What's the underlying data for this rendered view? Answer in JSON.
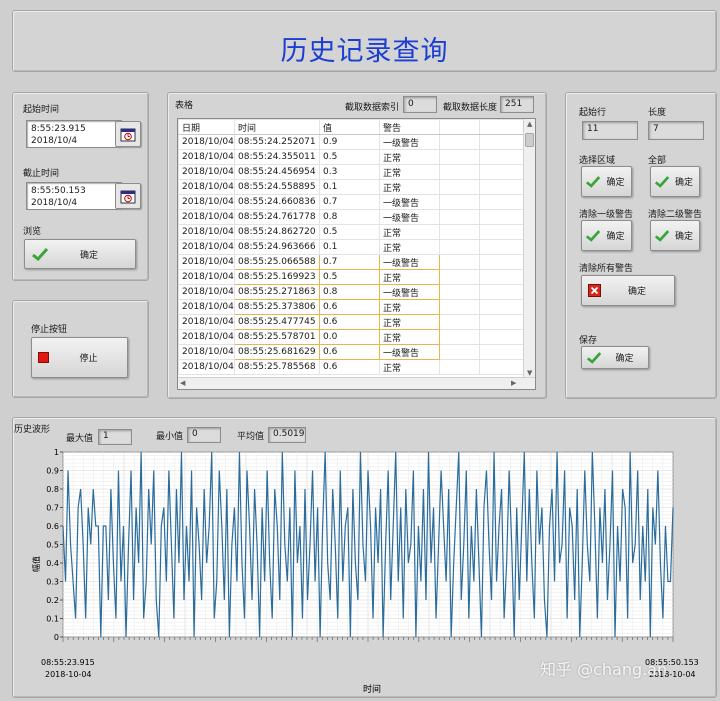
{
  "header": {
    "title": "历史记录查询"
  },
  "time_panel": {
    "start_label": "起始时间",
    "start_time": "8:55:23.915",
    "start_date": "2018/10/4",
    "end_label": "截止时间",
    "end_time": "8:55:50.153",
    "end_date": "2018/10/4",
    "browse_label": "浏览",
    "browse_button": "确定",
    "calendar_icon": "calendar-clock-icon"
  },
  "stop_panel": {
    "label": "停止按钮",
    "button": "停止",
    "indicator_color": "#e0190f"
  },
  "table_panel": {
    "label": "表格",
    "index_label": "截取数据索引",
    "index_value": "0",
    "length_label": "截取数据长度",
    "length_value": "251",
    "columns": [
      "日期",
      "时间",
      "值",
      "警告"
    ],
    "rows": [
      [
        "2018/10/04",
        "08:55:24.252071",
        "0.9",
        "一级警告"
      ],
      [
        "2018/10/04",
        "08:55:24.355011",
        "0.5",
        "正常"
      ],
      [
        "2018/10/04",
        "08:55:24.456954",
        "0.3",
        "正常"
      ],
      [
        "2018/10/04",
        "08:55:24.558895",
        "0.1",
        "正常"
      ],
      [
        "2018/10/04",
        "08:55:24.660836",
        "0.7",
        "一级警告"
      ],
      [
        "2018/10/04",
        "08:55:24.761778",
        "0.8",
        "一级警告"
      ],
      [
        "2018/10/04",
        "08:55:24.862720",
        "0.5",
        "正常"
      ],
      [
        "2018/10/04",
        "08:55:24.963666",
        "0.1",
        "正常"
      ],
      [
        "2018/10/04",
        "08:55:25.066588",
        "0.7",
        "一级警告"
      ],
      [
        "2018/10/04",
        "08:55:25.169923",
        "0.5",
        "正常"
      ],
      [
        "2018/10/04",
        "08:55:25.271863",
        "0.8",
        "一级警告"
      ],
      [
        "2018/10/04",
        "08:55:25.373806",
        "0.6",
        "正常"
      ],
      [
        "2018/10/04",
        "08:55:25.477745",
        "0.6",
        "正常"
      ],
      [
        "2018/10/04",
        "08:55:25.578701",
        "0.0",
        "正常"
      ],
      [
        "2018/10/04",
        "08:55:25.681629",
        "0.6",
        "一级警告"
      ],
      [
        "2018/10/04",
        "08:55:25.785568",
        "0.6",
        "正常"
      ]
    ],
    "highlighted_rows": [
      8,
      9,
      10,
      11,
      12,
      13,
      14
    ],
    "highlight_color": "#e1b84a"
  },
  "selection_panel": {
    "start_row_label": "起始行",
    "start_row_value": "11",
    "length_label": "长度",
    "length_value": "7",
    "select_region_label": "选择区域",
    "select_region_button": "确定",
    "all_label": "全部",
    "all_button": "确定",
    "clear_level1_label": "清除一级警告",
    "clear_level1_button": "确定",
    "clear_level2_label": "清除二级警告",
    "clear_level2_button": "确定",
    "clear_all_label": "清除所有警告",
    "clear_all_button": "确定",
    "save_label": "保存",
    "save_button": "确定"
  },
  "waveform_panel": {
    "label": "历史波形",
    "max_label": "最大值",
    "max_value": "1",
    "min_label": "最小值",
    "min_value": "0",
    "avg_label": "平均值",
    "avg_value": "0.5019"
  },
  "watermark": "知乎 @chang.an",
  "chart_data": {
    "type": "line",
    "title": "",
    "xlabel": "时间",
    "ylabel": "幅值",
    "x_start_label": [
      "08:55:23.915",
      "2018-10-04"
    ],
    "x_end_label": [
      "08:55:50.153",
      "2018-10-04"
    ],
    "ylim": [
      0,
      1
    ],
    "yticks": [
      "0",
      "0.1",
      "0.2",
      "0.3",
      "0.4",
      "0.5",
      "0.6",
      "0.7",
      "0.8",
      "0.9",
      "1"
    ],
    "grid": true,
    "line_color": "#2b6c9c",
    "values": [
      0.6,
      0.3,
      0.9,
      0.5,
      0.3,
      0.1,
      0.7,
      0.8,
      0.5,
      0.1,
      0.7,
      0.5,
      0.8,
      0.6,
      0.6,
      0.0,
      0.6,
      0.6,
      0.2,
      0.8,
      0.4,
      0.1,
      0.9,
      0.3,
      0.6,
      0.0,
      0.5,
      0.9,
      0.2,
      0.7,
      0.4,
      1.0,
      0.1,
      0.3,
      0.8,
      0.5,
      0.9,
      0.2,
      0.0,
      0.6,
      0.7,
      0.3,
      0.9,
      0.5,
      0.1,
      0.8,
      0.4,
      1.0,
      0.2,
      0.6,
      0.3,
      0.9,
      0.0,
      0.7,
      0.5,
      0.2,
      0.8,
      0.4,
      0.6,
      1.0,
      0.1,
      0.3,
      0.9,
      0.6,
      0.2,
      0.8,
      0.0,
      0.5,
      0.7,
      0.3,
      1.0,
      0.4,
      0.1,
      0.9,
      0.6,
      0.2,
      0.8,
      0.5,
      0.0,
      0.7,
      0.3,
      0.9,
      0.4,
      0.1,
      0.8,
      0.6,
      0.2,
      1.0,
      0.5,
      0.3,
      0.7,
      0.0,
      0.9,
      0.4,
      0.6,
      0.1,
      0.8,
      0.2,
      0.5,
      0.9,
      0.3,
      0.7,
      0.0,
      0.6,
      1.0,
      0.4,
      0.2,
      0.8,
      0.5,
      0.1,
      0.9,
      0.3,
      0.6,
      0.7,
      0.0,
      0.8,
      0.4,
      0.2,
      1.0,
      0.5,
      0.3,
      0.9,
      0.6,
      0.1,
      0.7,
      0.4,
      0.8,
      0.0,
      0.5,
      0.9,
      0.2,
      0.6,
      1.0,
      0.3,
      0.7,
      0.1,
      0.8,
      0.4,
      0.5,
      0.9,
      0.0,
      0.6,
      0.3,
      0.8,
      0.2,
      1.0,
      0.4,
      0.7,
      0.1,
      0.5,
      0.9,
      0.6,
      0.3,
      0.8,
      0.0,
      0.4,
      0.7,
      1.0,
      0.2,
      0.5,
      0.9,
      0.1,
      0.6,
      0.3,
      0.8,
      0.4,
      0.0,
      0.7,
      0.9,
      0.5,
      0.2,
      1.0,
      0.3,
      0.6,
      0.8,
      0.1,
      0.4,
      0.9,
      0.5,
      0.0,
      0.7,
      0.2,
      0.6,
      1.0,
      0.3,
      0.8,
      0.4,
      0.1,
      0.9,
      0.5,
      0.7,
      0.2,
      0.0,
      0.6,
      0.8,
      0.3,
      1.0,
      0.4,
      0.5,
      0.9,
      0.1,
      0.7,
      0.6,
      0.2,
      0.8,
      0.0,
      0.4,
      0.9,
      0.5,
      0.3,
      1.0,
      0.6,
      0.1,
      0.7,
      0.4,
      0.8,
      0.2,
      0.5,
      0.9,
      0.0,
      0.6,
      0.3,
      0.8,
      0.7,
      0.1,
      1.0,
      0.4,
      0.5,
      0.9,
      0.2,
      0.6,
      0.3,
      0.8,
      0.0,
      0.7,
      0.5,
      0.9,
      0.4,
      0.1,
      0.6,
      0.3,
      0.3,
      0.7
    ]
  }
}
